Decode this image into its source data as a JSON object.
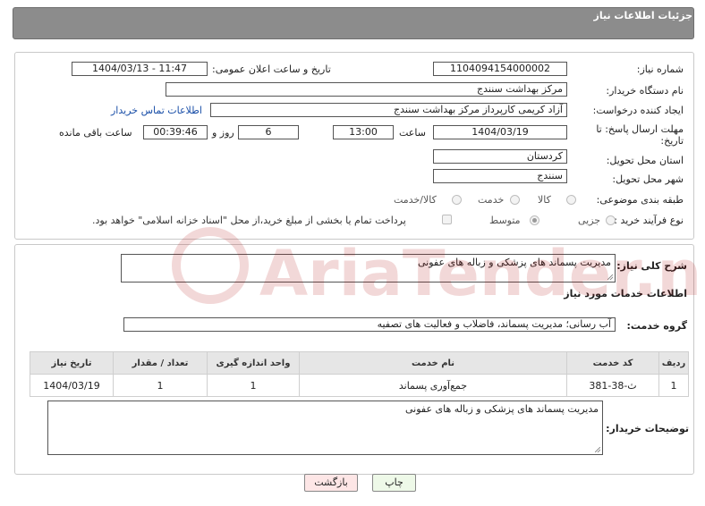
{
  "header": {
    "title": "جزئیات اطلاعات نیاز"
  },
  "form": {
    "need_number_label": "شماره نیاز:",
    "need_number": "1104094154000002",
    "announce_label": "تاریخ و ساعت اعلان عمومی:",
    "announce_value": "1404/03/13 - 11:47",
    "buyer_org_label": "نام دستگاه خریدار:",
    "buyer_org": "مرکز بهداشت سنندج",
    "creator_label": "ایجاد کننده درخواست:",
    "creator": "آزاد کریمی کارپرداز مرکز بهداشت سنندج",
    "contact_link": "اطلاعات تماس خریدار",
    "deadline_label_1": "مهلت ارسال پاسخ: تا",
    "deadline_label_2": "تاریخ:",
    "deadline_date": "1404/03/19",
    "time_label": "ساعت",
    "deadline_time": "13:00",
    "days_value": "6",
    "days_label": "روز و",
    "remaining_value": "00:39:46",
    "remaining_label": "ساعت باقی مانده",
    "province_label": "استان محل تحویل:",
    "province": "کردستان",
    "city_label": "شهر محل تحویل:",
    "city": "سنندج",
    "category_label": "طبقه بندی موضوعی:",
    "category_options": [
      "کالا",
      "خدمت",
      "کالا/خدمت"
    ],
    "process_label": "نوع فرآیند خرید :",
    "process_options": [
      "جزیی",
      "متوسط"
    ],
    "payment_note": "پرداخت تمام یا بخشی از مبلغ خرید،از محل \"اسناد خزانه اسلامی\" خواهد بود."
  },
  "summary": {
    "label": "شرح کلی نیاز:",
    "text": "مدیریت پسماند های پزشکی و زباله های عفونی"
  },
  "services": {
    "section_title": "اطلاعات خدمات مورد نیاز",
    "group_label": "گروه خدمت:",
    "group_value": "آب رسانی؛ مدیریت پسماند، فاضلاب و فعالیت های تصفیه",
    "columns": [
      "ردیف",
      "کد خدمت",
      "نام خدمت",
      "واحد اندازه گیری",
      "تعداد / مقدار",
      "تاریخ نیاز"
    ],
    "rows": [
      [
        "1",
        "ث-38-381",
        "جمع‌آوری پسماند",
        "1",
        "1",
        "1404/03/19"
      ]
    ]
  },
  "buyer_notes": {
    "label": "توضیحات خریدار:",
    "text": "مدیریت پسماند های پزشکی و زباله های عفونی"
  },
  "buttons": {
    "print": "چاپ",
    "back": "بازگشت"
  },
  "watermark": {
    "text": "AriaTender.net"
  }
}
